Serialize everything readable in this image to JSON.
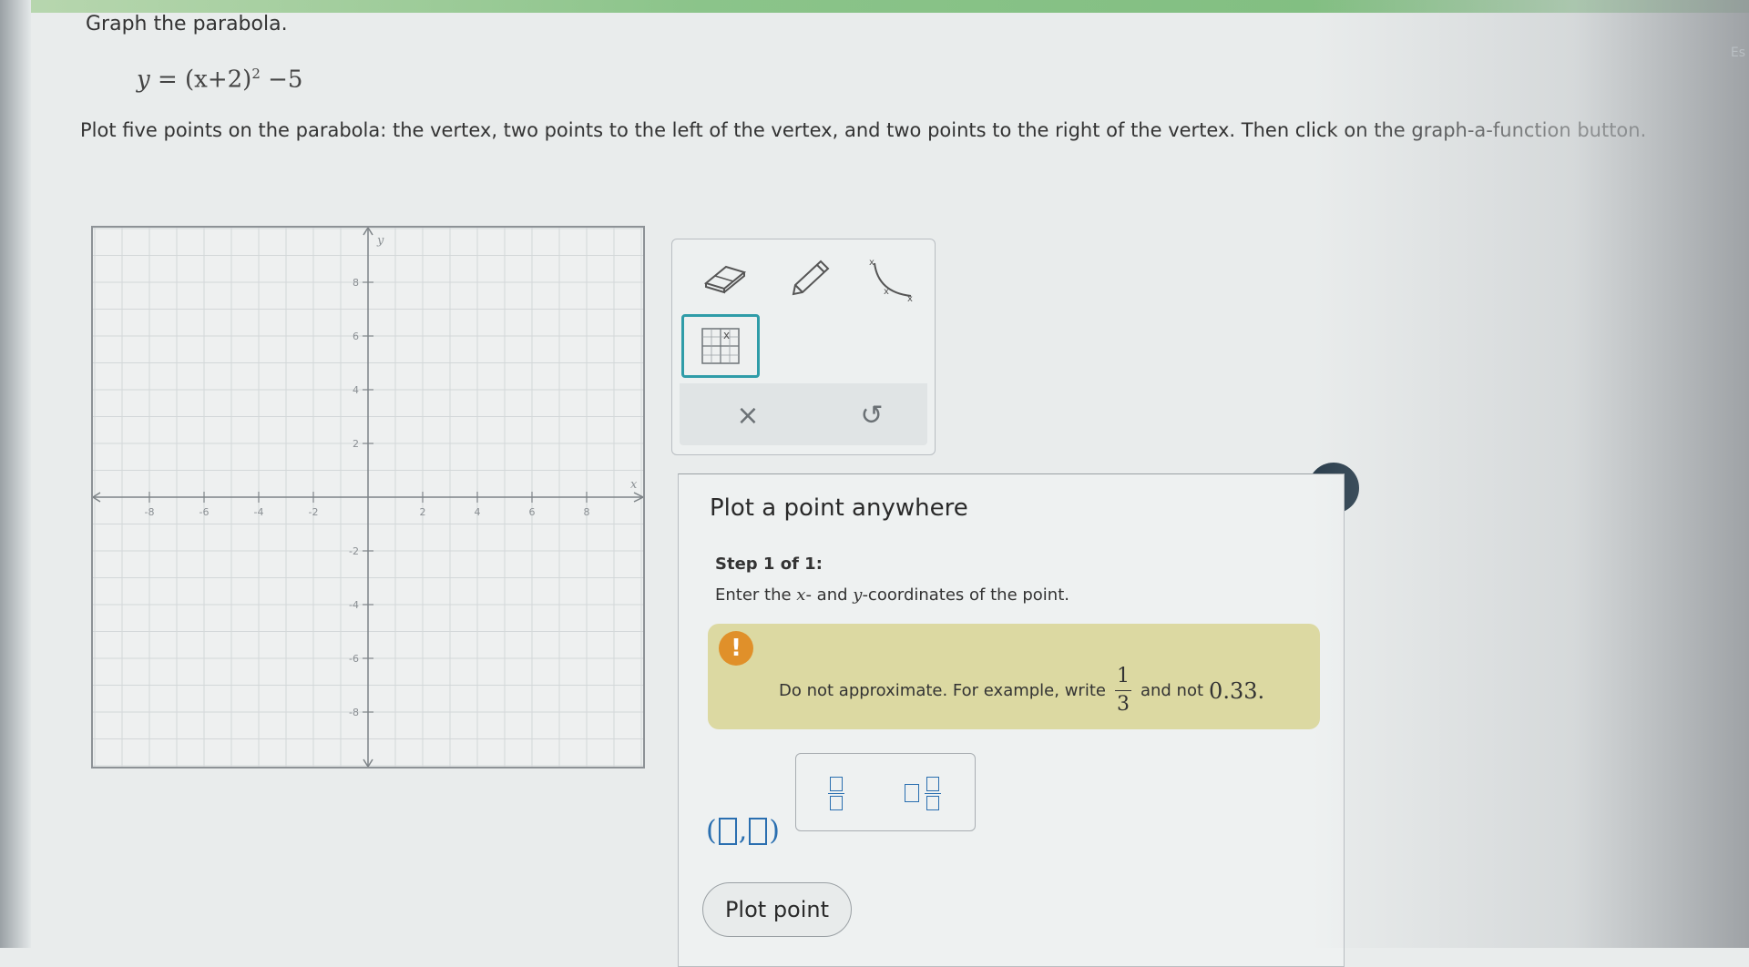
{
  "problem": {
    "title": "Graph the parabola.",
    "equation_lhs": "y",
    "equation_eq": "=",
    "equation_base": "(x+2)",
    "equation_exp": "2",
    "equation_tail": "−5",
    "instructions": "Plot five points on the parabola: the vertex, two points to the left of the vertex, and two points to the right of the vertex. Then click on the graph-a-function button."
  },
  "graph": {
    "x_axis_label": "x",
    "y_axis_label": "y",
    "x_ticks": [
      "-8",
      "-6",
      "-4",
      "-2",
      "2",
      "4",
      "6",
      "8"
    ],
    "y_ticks": [
      "8",
      "6",
      "4",
      "2",
      "-2",
      "-4",
      "-6",
      "-8"
    ]
  },
  "toolbox": {
    "eraser_icon": "eraser-icon",
    "pencil_icon": "pencil-icon",
    "curve_icon": "graph-function-icon",
    "point_icon": "plot-point-icon",
    "clear_symbol": "×",
    "undo_symbol": "↺"
  },
  "panel": {
    "title": "Plot a point anywhere",
    "step_label": "Step 1 of 1:",
    "step_text_a": "Enter the ",
    "step_x": "x",
    "step_text_b": "- and ",
    "step_y": "y",
    "step_text_c": "-coordinates of the point.",
    "warning_icon": "!",
    "warning_text": "Do not approximate. For example, write",
    "warning_frac_num": "1",
    "warning_frac_den": "3",
    "warning_and_not": "and not",
    "warning_decimal": "0.33.",
    "close_symbol": "×",
    "plot_button": "Plot point"
  },
  "page": {
    "right_edge_text": "Es"
  }
}
